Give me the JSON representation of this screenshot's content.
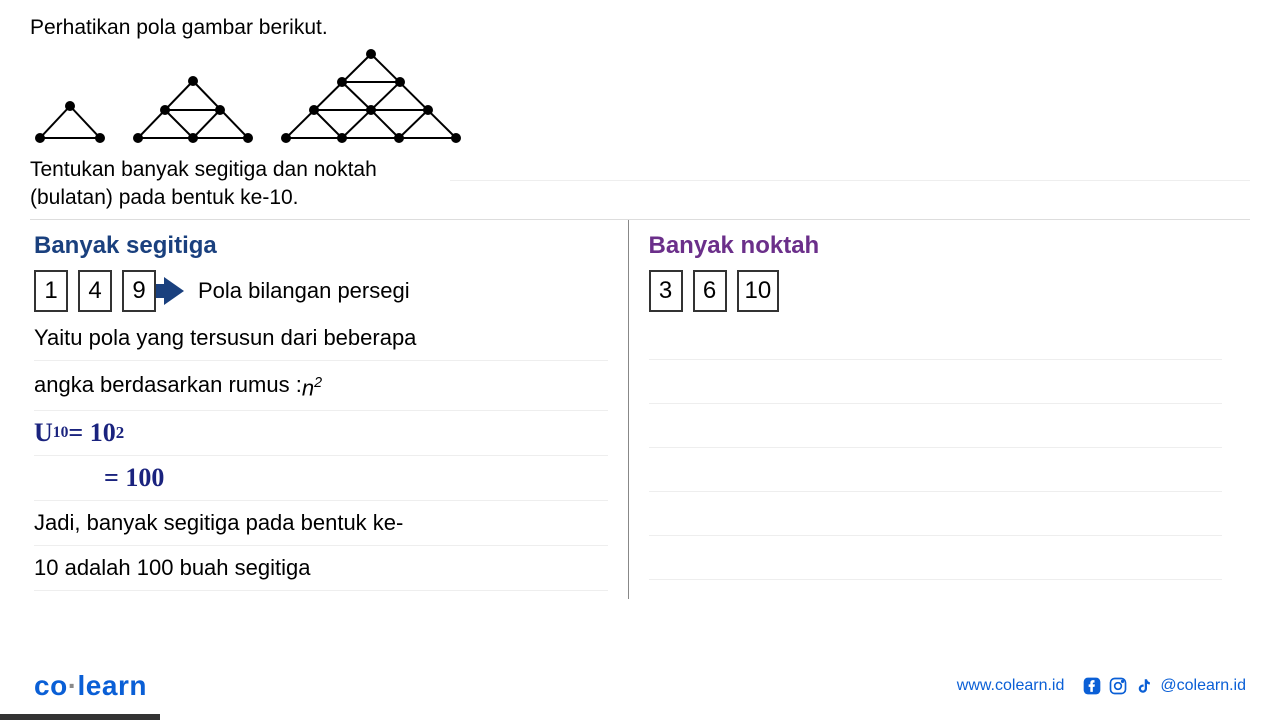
{
  "intro": "Perhatikan pola gambar berikut.",
  "question_line1": "Tentukan banyak segitiga dan noktah",
  "question_line2": "(bulatan) pada bentuk ke-10.",
  "left": {
    "heading": "Banyak segitiga",
    "nums": [
      "1",
      "4",
      "9"
    ],
    "pattern_label": "Pola bilangan persegi",
    "desc_line1": "Yaitu pola yang tersusun dari beberapa",
    "desc_line2_prefix": "angka berdasarkan rumus : ",
    "formula_base": "n",
    "formula_exp": "2",
    "hand_eq_lhs": "U",
    "hand_eq_sub": "10",
    "hand_eq_eq": " = 10",
    "hand_eq_exp": "2",
    "hand_eq_line2": "= 100",
    "conclusion_line1": "Jadi, banyak segitiga pada bentuk ke-",
    "conclusion_line2": "10 adalah 100 buah segitiga"
  },
  "right": {
    "heading": "Banyak noktah",
    "nums": [
      "3",
      "6",
      "10"
    ]
  },
  "footer": {
    "logo_left": "co",
    "logo_right": "learn",
    "url": "www.colearn.id",
    "handle": "@colearn.id"
  },
  "icons": {
    "arrow": "arrow-right-icon",
    "fb": "facebook-icon",
    "ig": "instagram-icon",
    "tt": "tiktok-icon"
  }
}
